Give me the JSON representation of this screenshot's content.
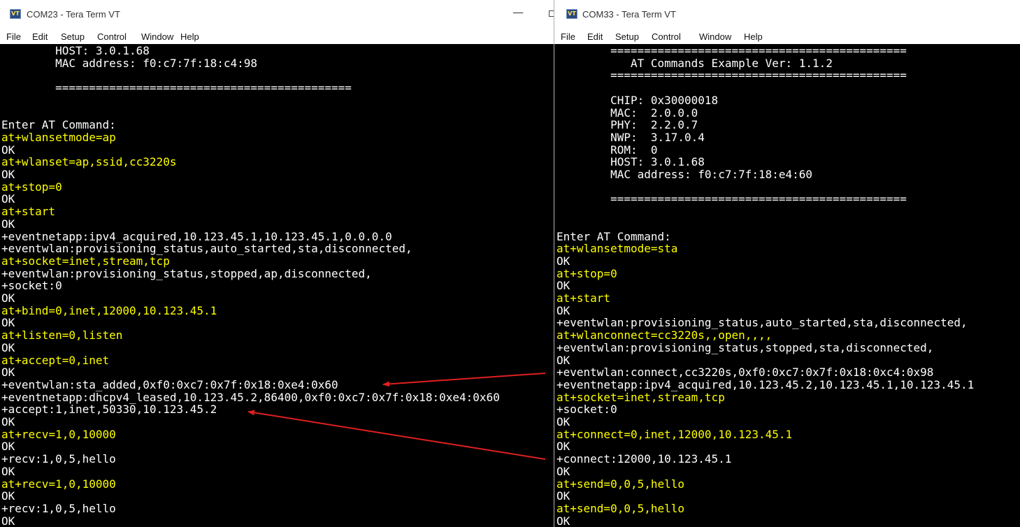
{
  "colors": {
    "terminal_bg": "#000000",
    "output_text": "#ffffff",
    "command_text": "#ffff00",
    "arrow": "#e02020"
  },
  "left_window": {
    "title": "COM23 - Tera Term VT",
    "icon": "VT",
    "minimize": "—",
    "menu": [
      "File",
      "Edit",
      "Setup",
      "Control",
      "Window",
      "Help"
    ],
    "lines": [
      {
        "text": "        HOST: 3.0.1.68",
        "cmd": false
      },
      {
        "text": "        MAC address: f0:c7:7f:18:c4:98",
        "cmd": false
      },
      {
        "text": "",
        "cmd": false
      },
      {
        "text": "        ============================================",
        "cmd": false
      },
      {
        "text": "",
        "cmd": false
      },
      {
        "text": "",
        "cmd": false
      },
      {
        "text": "Enter AT Command:",
        "cmd": false
      },
      {
        "text": "at+wlansetmode=ap",
        "cmd": true
      },
      {
        "text": "OK",
        "cmd": false
      },
      {
        "text": "at+wlanset=ap,ssid,cc3220s",
        "cmd": true
      },
      {
        "text": "OK",
        "cmd": false
      },
      {
        "text": "at+stop=0",
        "cmd": true
      },
      {
        "text": "OK",
        "cmd": false
      },
      {
        "text": "at+start",
        "cmd": true
      },
      {
        "text": "OK",
        "cmd": false
      },
      {
        "text": "+eventnetapp:ipv4_acquired,10.123.45.1,10.123.45.1,0.0.0.0",
        "cmd": false
      },
      {
        "text": "+eventwlan:provisioning_status,auto_started,sta,disconnected,",
        "cmd": false
      },
      {
        "text": "at+socket=inet,stream,tcp",
        "cmd": true
      },
      {
        "text": "+eventwlan:provisioning_status,stopped,ap,disconnected,",
        "cmd": false
      },
      {
        "text": "+socket:0",
        "cmd": false
      },
      {
        "text": "OK",
        "cmd": false
      },
      {
        "text": "at+bind=0,inet,12000,10.123.45.1",
        "cmd": true
      },
      {
        "text": "OK",
        "cmd": false
      },
      {
        "text": "at+listen=0,listen",
        "cmd": true
      },
      {
        "text": "OK",
        "cmd": false
      },
      {
        "text": "at+accept=0,inet",
        "cmd": true
      },
      {
        "text": "OK",
        "cmd": false
      },
      {
        "text": "+eventwlan:sta_added,0xf0:0xc7:0x7f:0x18:0xe4:0x60",
        "cmd": false
      },
      {
        "text": "+eventnetapp:dhcpv4_leased,10.123.45.2,86400,0xf0:0xc7:0x7f:0x18:0xe4:0x60",
        "cmd": false
      },
      {
        "text": "+accept:1,inet,50330,10.123.45.2",
        "cmd": false
      },
      {
        "text": "OK",
        "cmd": false
      },
      {
        "text": "at+recv=1,0,10000",
        "cmd": true
      },
      {
        "text": "OK",
        "cmd": false
      },
      {
        "text": "+recv:1,0,5,hello",
        "cmd": false
      },
      {
        "text": "OK",
        "cmd": false
      },
      {
        "text": "at+recv=1,0,10000",
        "cmd": true
      },
      {
        "text": "OK",
        "cmd": false
      },
      {
        "text": "+recv:1,0,5,hello",
        "cmd": false
      },
      {
        "text": "OK",
        "cmd": false
      }
    ]
  },
  "right_window": {
    "title": "COM33 - Tera Term VT",
    "icon": "VT",
    "menu": [
      "File",
      "Edit",
      "Setup",
      "Control",
      "Window",
      "Help"
    ],
    "lines": [
      {
        "text": "        ============================================",
        "cmd": false
      },
      {
        "text": "           AT Commands Example Ver: 1.1.2",
        "cmd": false
      },
      {
        "text": "        ============================================",
        "cmd": false
      },
      {
        "text": "",
        "cmd": false
      },
      {
        "text": "        CHIP: 0x30000018",
        "cmd": false
      },
      {
        "text": "        MAC:  2.0.0.0",
        "cmd": false
      },
      {
        "text": "        PHY:  2.2.0.7",
        "cmd": false
      },
      {
        "text": "        NWP:  3.17.0.4",
        "cmd": false
      },
      {
        "text": "        ROM:  0",
        "cmd": false
      },
      {
        "text": "        HOST: 3.0.1.68",
        "cmd": false
      },
      {
        "text": "        MAC address: f0:c7:7f:18:e4:60",
        "cmd": false
      },
      {
        "text": "",
        "cmd": false
      },
      {
        "text": "        ============================================",
        "cmd": false
      },
      {
        "text": "",
        "cmd": false
      },
      {
        "text": "",
        "cmd": false
      },
      {
        "text": "Enter AT Command:",
        "cmd": false
      },
      {
        "text": "at+wlansetmode=sta",
        "cmd": true
      },
      {
        "text": "OK",
        "cmd": false
      },
      {
        "text": "at+stop=0",
        "cmd": true
      },
      {
        "text": "OK",
        "cmd": false
      },
      {
        "text": "at+start",
        "cmd": true
      },
      {
        "text": "OK",
        "cmd": false
      },
      {
        "text": "+eventwlan:provisioning_status,auto_started,sta,disconnected,",
        "cmd": false
      },
      {
        "text": "at+wlanconnect=cc3220s,,open,,,,",
        "cmd": true
      },
      {
        "text": "+eventwlan:provisioning_status,stopped,sta,disconnected,",
        "cmd": false
      },
      {
        "text": "OK",
        "cmd": false
      },
      {
        "text": "+eventwlan:connect,cc3220s,0xf0:0xc7:0x7f:0x18:0xc4:0x98",
        "cmd": false
      },
      {
        "text": "+eventnetapp:ipv4_acquired,10.123.45.2,10.123.45.1,10.123.45.1",
        "cmd": false
      },
      {
        "text": "at+socket=inet,stream,tcp",
        "cmd": true
      },
      {
        "text": "+socket:0",
        "cmd": false
      },
      {
        "text": "OK",
        "cmd": false
      },
      {
        "text": "at+connect=0,inet,12000,10.123.45.1",
        "cmd": true
      },
      {
        "text": "OK",
        "cmd": false
      },
      {
        "text": "+connect:12000,10.123.45.1",
        "cmd": false
      },
      {
        "text": "OK",
        "cmd": false
      },
      {
        "text": "at+send=0,0,5,hello",
        "cmd": true
      },
      {
        "text": "OK",
        "cmd": false
      },
      {
        "text": "at+send=0,0,5,hello",
        "cmd": true
      },
      {
        "text": "OK",
        "cmd": false
      }
    ]
  }
}
